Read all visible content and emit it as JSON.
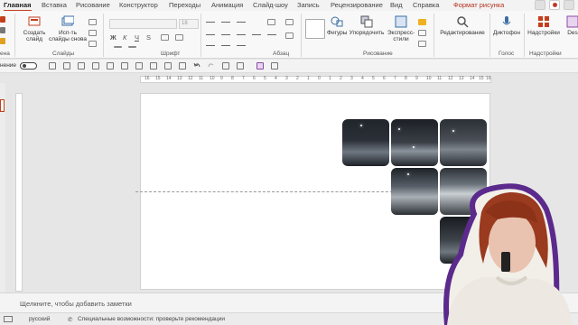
{
  "tabs": [
    "Главная",
    "Вставка",
    "Рисование",
    "Конструктор",
    "Переходы",
    "Анимация",
    "Слайд-шоу",
    "Запись",
    "Рецензирование",
    "Вид",
    "Справка",
    "Формат рисунка"
  ],
  "ribbon": {
    "create_slide": "Создать",
    "create_slide2": "слайд",
    "reuse_slides": "Исп-ть",
    "reuse_slides2": "слайды снова",
    "font_size": "18",
    "bold": "Ж",
    "italic": "К",
    "underline": "Ч",
    "strike": "S",
    "shapes": "Фигуры",
    "arrange": "Упорядочить",
    "express_styles": "Экспресс-",
    "express_styles2": "стили",
    "editing": "Редактирование",
    "dictation": "Диктофон",
    "addins": "Надстройки",
    "designer": "Des",
    "groups": {
      "clipboard": "ена",
      "slides": "Слайды",
      "font": "Шрифт",
      "paragraph": "Абзац",
      "drawing": "Рисование",
      "voice": "Голос",
      "addins": "Надстройки"
    }
  },
  "qat": {
    "label": "нение"
  },
  "ruler": [
    "16",
    "15",
    "14",
    "13",
    "12",
    "11",
    "10",
    "9",
    "8",
    "7",
    "6",
    "5",
    "4",
    "3",
    "2",
    "1",
    "0",
    "1",
    "2",
    "3",
    "4",
    "5",
    "6",
    "7",
    "8",
    "9",
    "10",
    "11",
    "12",
    "13",
    "14",
    "15",
    "16"
  ],
  "notes": {
    "placeholder": "Щелкните, чтобы добавить заметки"
  },
  "status": {
    "language": "русский",
    "accessibility": "Специальные возможности: проверьте рекомендации"
  },
  "colors": {
    "accent": "#c43e1c",
    "frame": "#5b2a8c"
  }
}
